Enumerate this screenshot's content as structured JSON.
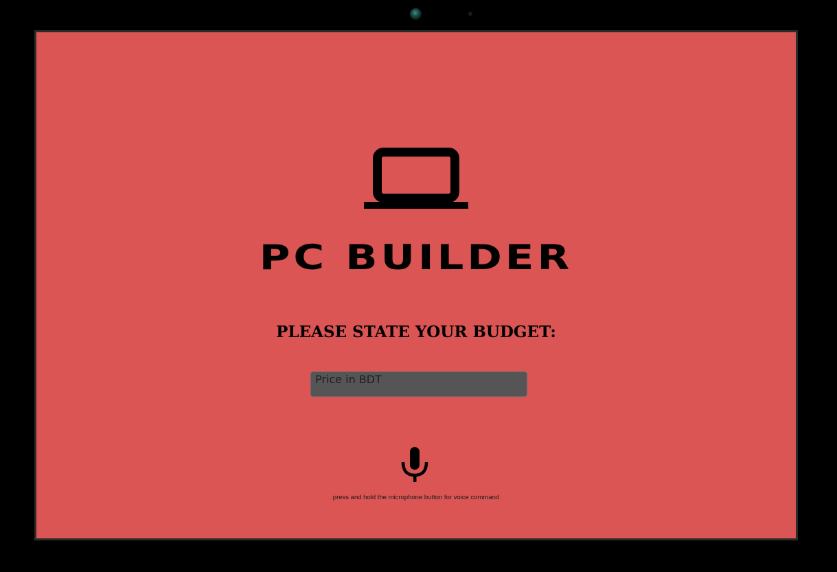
{
  "app": {
    "title": "PC BUILDER"
  },
  "main": {
    "icon": "laptop-icon",
    "prompt": "PLEASE STATE YOUR BUDGET:",
    "price_input": {
      "placeholder": "Price in BDT",
      "value": ""
    },
    "mic_icon": "microphone-icon",
    "hint": "press and hold the microphone button for voice command"
  },
  "colors": {
    "screen_background": "#da5553",
    "device_frame": "#000000",
    "input_background": "#555555",
    "text": "#000000"
  }
}
